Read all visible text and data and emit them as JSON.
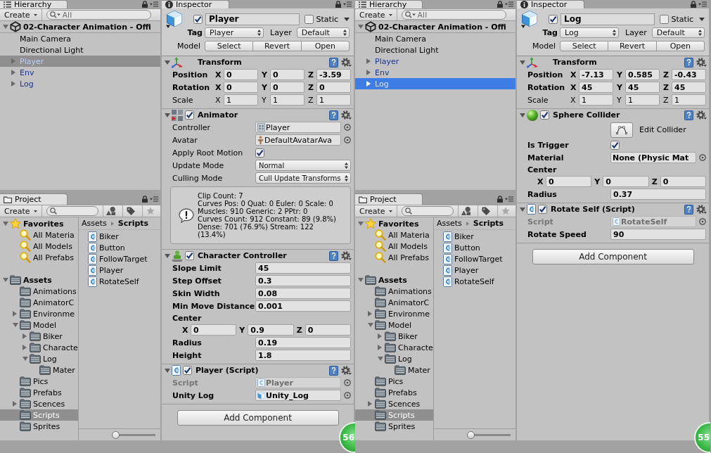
{
  "editors": [
    {
      "hierarchy": {
        "title": "Hierarchy",
        "create": "Create",
        "search": {
          "placeholder": "All"
        },
        "focused": false,
        "scene": {
          "name": "02-Character Animation - Offi",
          "expanded": true
        },
        "items": [
          {
            "name": "Main Camera",
            "prefab": false,
            "selected": false
          },
          {
            "name": "Directional Light",
            "prefab": false,
            "selected": false
          },
          {
            "name": "Player",
            "prefab": true,
            "expanded": false,
            "selected": true
          },
          {
            "name": "Env",
            "prefab": true,
            "expanded": false,
            "selected": false
          },
          {
            "name": "Log",
            "prefab": true,
            "expanded": false,
            "selected": false
          }
        ]
      },
      "project": {
        "title": "Project",
        "create": "Create",
        "tree": [
          {
            "name": "Favorites",
            "kind": "favorites",
            "expanded": true,
            "selected": false,
            "children": [
              {
                "name": "All Materia",
                "kind": "search",
                "selected": false
              },
              {
                "name": "All Models",
                "kind": "search",
                "selected": false
              },
              {
                "name": "All Prefabs",
                "kind": "search",
                "selected": false
              }
            ]
          },
          {
            "name": "Assets",
            "kind": "folder",
            "expanded": true,
            "selected": false,
            "children": [
              {
                "name": "Animations",
                "kind": "folder",
                "selected": false
              },
              {
                "name": "AnimatorC",
                "kind": "folder",
                "selected": false
              },
              {
                "name": "Environme",
                "kind": "folder",
                "expanded": false,
                "selected": false
              },
              {
                "name": "Model",
                "kind": "folder",
                "expanded": true,
                "selected": false,
                "children": [
                  {
                    "name": "Biker",
                    "kind": "folder",
                    "expanded": false,
                    "selected": false
                  },
                  {
                    "name": "Characte",
                    "kind": "folder",
                    "expanded": false,
                    "selected": false
                  },
                  {
                    "name": "Log",
                    "kind": "folder",
                    "expanded": true,
                    "selected": false,
                    "children": [
                      {
                        "name": "Mater",
                        "kind": "folder",
                        "selected": false
                      }
                    ]
                  }
                ]
              },
              {
                "name": "Pics",
                "kind": "folder",
                "selected": false
              },
              {
                "name": "Prefabs",
                "kind": "folder",
                "selected": false
              },
              {
                "name": "Scences",
                "kind": "folder",
                "expanded": false,
                "selected": false
              },
              {
                "name": "Scripts",
                "kind": "folder",
                "selected": true
              },
              {
                "name": "Sprites",
                "kind": "folder",
                "selected": false
              }
            ]
          }
        ],
        "breadcrumb": [
          "Assets",
          "Scripts"
        ],
        "files": [
          {
            "name": "Biker",
            "selected": false
          },
          {
            "name": "Button",
            "selected": false
          },
          {
            "name": "FollowTarget",
            "selected": false
          },
          {
            "name": "Player",
            "selected": false
          },
          {
            "name": "RotateSelf",
            "selected": false
          }
        ],
        "size_slider": {
          "level": 0
        }
      },
      "inspector": {
        "title": "Inspector",
        "object": {
          "active": true,
          "name": "Player",
          "static": false,
          "static_label": "Static",
          "tag_label": "Tag",
          "tag": "Player",
          "layer_label": "Layer",
          "layer": "Default",
          "prefab_label": "Model",
          "prefab_buttons": [
            "Select",
            "Revert",
            "Open"
          ]
        },
        "components": [
          {
            "kind": "transform",
            "title": "Transform",
            "expanded": true,
            "rows": [
              {
                "kind": "vector3",
                "label": "Position",
                "modified": true,
                "axes": [
                  {
                    "axis": "X",
                    "value": "0"
                  },
                  {
                    "axis": "Y",
                    "value": "0"
                  },
                  {
                    "axis": "Z",
                    "value": "-3.59"
                  }
                ]
              },
              {
                "kind": "vector3",
                "label": "Rotation",
                "modified": true,
                "axes": [
                  {
                    "axis": "X",
                    "value": "0"
                  },
                  {
                    "axis": "Y",
                    "value": "0"
                  },
                  {
                    "axis": "Z",
                    "value": "0"
                  }
                ]
              },
              {
                "kind": "vector3",
                "label": "Scale",
                "modified": false,
                "axes": [
                  {
                    "axis": "X",
                    "value": "1"
                  },
                  {
                    "axis": "Y",
                    "value": "1"
                  },
                  {
                    "axis": "Z",
                    "value": "1"
                  }
                ]
              }
            ]
          },
          {
            "kind": "animator",
            "title": "Animator",
            "enabled": true,
            "expanded": true,
            "rows": [
              {
                "kind": "controller-field",
                "label": "Controller",
                "value": "Player",
                "modified": false,
                "disabled": false
              },
              {
                "kind": "avatar-field",
                "label": "Avatar",
                "value": "DefaultAvatarAva",
                "modified": false,
                "disabled": false
              },
              {
                "kind": "checkbox",
                "label": "Apply Root Motion",
                "checked": true,
                "modified": false
              },
              {
                "kind": "dropdown",
                "label": "Update Mode",
                "value": "Normal",
                "modified": false
              },
              {
                "kind": "dropdown",
                "label": "Culling Mode",
                "value": "Cull Update Transforms",
                "modified": false
              },
              {
                "kind": "info",
                "text": "Clip Count: 7\nCurves Pos: 0 Quat: 0 Euler: 0 Scale: 0\nMuscles: 910 Generic: 2 PPtr: 0\nCurves Count: 912 Constant: 89 (9.8%)\nDense: 701 (76.9%) Stream: 122 (13.4%)"
              }
            ]
          },
          {
            "kind": "character-controller",
            "title": "Character Controller",
            "enabled": true,
            "expanded": true,
            "rows": [
              {
                "kind": "field",
                "label": "Slope Limit",
                "value": "45",
                "modified": true
              },
              {
                "kind": "field",
                "label": "Step Offset",
                "value": "0.3",
                "modified": true
              },
              {
                "kind": "field",
                "label": "Skin Width",
                "value": "0.08",
                "modified": true
              },
              {
                "kind": "field",
                "label": "Min Move Distance",
                "value": "0.001",
                "modified": true
              },
              {
                "kind": "vector3-block",
                "label": "Center",
                "modified": true,
                "axes": [
                  {
                    "axis": "X",
                    "value": "0"
                  },
                  {
                    "axis": "Y",
                    "value": "0.9"
                  },
                  {
                    "axis": "Z",
                    "value": "0"
                  }
                ]
              },
              {
                "kind": "field",
                "label": "Radius",
                "value": "0.19",
                "modified": true
              },
              {
                "kind": "field",
                "label": "Height",
                "value": "1.8",
                "modified": true
              }
            ]
          },
          {
            "kind": "script",
            "title": "Player (Script)",
            "enabled": true,
            "expanded": true,
            "rows": [
              {
                "kind": "script-field",
                "label": "Script",
                "value": "Player",
                "modified": true,
                "disabled": true
              },
              {
                "kind": "gameobject-field",
                "label": "Unity Log",
                "value": "Unity_Log",
                "modified": true,
                "disabled": false
              }
            ]
          }
        ],
        "add_button": "Add Component"
      },
      "overlay_badge": "56"
    },
    {
      "hierarchy": {
        "title": "Hierarchy",
        "create": "Create",
        "search": {
          "placeholder": "All"
        },
        "focused": true,
        "scene": {
          "name": "02-Character Animation - Offi",
          "expanded": true
        },
        "items": [
          {
            "name": "Main Camera",
            "prefab": false,
            "selected": false
          },
          {
            "name": "Directional Light",
            "prefab": false,
            "selected": false
          },
          {
            "name": "Player",
            "prefab": true,
            "expanded": false,
            "selected": false
          },
          {
            "name": "Env",
            "prefab": true,
            "expanded": false,
            "selected": false
          },
          {
            "name": "Log",
            "prefab": true,
            "expanded": false,
            "selected": true
          }
        ]
      },
      "project": {
        "title": "Project",
        "create": "Create",
        "tree": [
          {
            "name": "Favorites",
            "kind": "favorites",
            "expanded": true,
            "selected": false,
            "children": [
              {
                "name": "All Materia",
                "kind": "search",
                "selected": false
              },
              {
                "name": "All Models",
                "kind": "search",
                "selected": false
              },
              {
                "name": "All Prefabs",
                "kind": "search",
                "selected": false
              }
            ]
          },
          {
            "name": "Assets",
            "kind": "folder",
            "expanded": true,
            "selected": false,
            "children": [
              {
                "name": "Animations",
                "kind": "folder",
                "selected": false
              },
              {
                "name": "AnimatorC",
                "kind": "folder",
                "selected": false
              },
              {
                "name": "Environme",
                "kind": "folder",
                "expanded": false,
                "selected": false
              },
              {
                "name": "Model",
                "kind": "folder",
                "expanded": true,
                "selected": false,
                "children": [
                  {
                    "name": "Biker",
                    "kind": "folder",
                    "expanded": false,
                    "selected": false
                  },
                  {
                    "name": "Characte",
                    "kind": "folder",
                    "expanded": false,
                    "selected": false
                  },
                  {
                    "name": "Log",
                    "kind": "folder",
                    "expanded": true,
                    "selected": false,
                    "children": [
                      {
                        "name": "Mater",
                        "kind": "folder",
                        "selected": false
                      }
                    ]
                  }
                ]
              },
              {
                "name": "Pics",
                "kind": "folder",
                "selected": false
              },
              {
                "name": "Prefabs",
                "kind": "folder",
                "selected": false
              },
              {
                "name": "Scences",
                "kind": "folder",
                "expanded": false,
                "selected": false
              },
              {
                "name": "Scripts",
                "kind": "folder",
                "selected": true
              },
              {
                "name": "Sprites",
                "kind": "folder",
                "selected": false
              }
            ]
          }
        ],
        "breadcrumb": [
          "Assets",
          "Scripts"
        ],
        "files": [
          {
            "name": "Biker",
            "selected": false
          },
          {
            "name": "Button",
            "selected": false
          },
          {
            "name": "FollowTarget",
            "selected": false
          },
          {
            "name": "Player",
            "selected": false
          },
          {
            "name": "RotateSelf",
            "selected": false
          }
        ],
        "size_slider": {
          "level": 0
        }
      },
      "inspector": {
        "title": "Inspector",
        "object": {
          "active": true,
          "name": "Log",
          "static": false,
          "static_label": "Static",
          "tag_label": "Tag",
          "tag": "Log",
          "layer_label": "Layer",
          "layer": "Default",
          "prefab_label": "Model",
          "prefab_buttons": [
            "Select",
            "Revert",
            "Open"
          ]
        },
        "components": [
          {
            "kind": "transform",
            "title": "Transform",
            "expanded": true,
            "rows": [
              {
                "kind": "vector3",
                "label": "Position",
                "modified": true,
                "axes": [
                  {
                    "axis": "X",
                    "value": "-7.13"
                  },
                  {
                    "axis": "Y",
                    "value": "0.585"
                  },
                  {
                    "axis": "Z",
                    "value": "-0.43"
                  }
                ]
              },
              {
                "kind": "vector3",
                "label": "Rotation",
                "modified": true,
                "axes": [
                  {
                    "axis": "X",
                    "value": "45"
                  },
                  {
                    "axis": "Y",
                    "value": "45"
                  },
                  {
                    "axis": "Z",
                    "value": "45"
                  }
                ]
              },
              {
                "kind": "vector3",
                "label": "Scale",
                "modified": false,
                "axes": [
                  {
                    "axis": "X",
                    "value": "1"
                  },
                  {
                    "axis": "Y",
                    "value": "1"
                  },
                  {
                    "axis": "Z",
                    "value": "1"
                  }
                ]
              }
            ]
          },
          {
            "kind": "sphere-collider",
            "title": "Sphere Collider",
            "enabled": true,
            "expanded": true,
            "rows": [
              {
                "kind": "button",
                "label": "Edit Collider"
              },
              {
                "kind": "checkbox",
                "label": "Is Trigger",
                "checked": true,
                "modified": true
              },
              {
                "kind": "material-field",
                "label": "Material",
                "value": "None (Physic Mat",
                "modified": true,
                "disabled": false
              },
              {
                "kind": "vector3-block",
                "label": "Center",
                "modified": true,
                "axes": [
                  {
                    "axis": "X",
                    "value": "0"
                  },
                  {
                    "axis": "Y",
                    "value": "0"
                  },
                  {
                    "axis": "Z",
                    "value": "0"
                  }
                ]
              },
              {
                "kind": "field",
                "label": "Radius",
                "value": "0.37",
                "modified": true
              }
            ]
          },
          {
            "kind": "script",
            "title": "Rotate Self (Script)",
            "enabled": true,
            "expanded": true,
            "rows": [
              {
                "kind": "script-field",
                "label": "Script",
                "value": "RotateSelf",
                "modified": true,
                "disabled": true
              },
              {
                "kind": "field",
                "label": "Rotate Speed",
                "value": "90",
                "modified": true
              }
            ]
          }
        ],
        "add_button": "Add Component"
      },
      "overlay_badge": "55"
    }
  ]
}
